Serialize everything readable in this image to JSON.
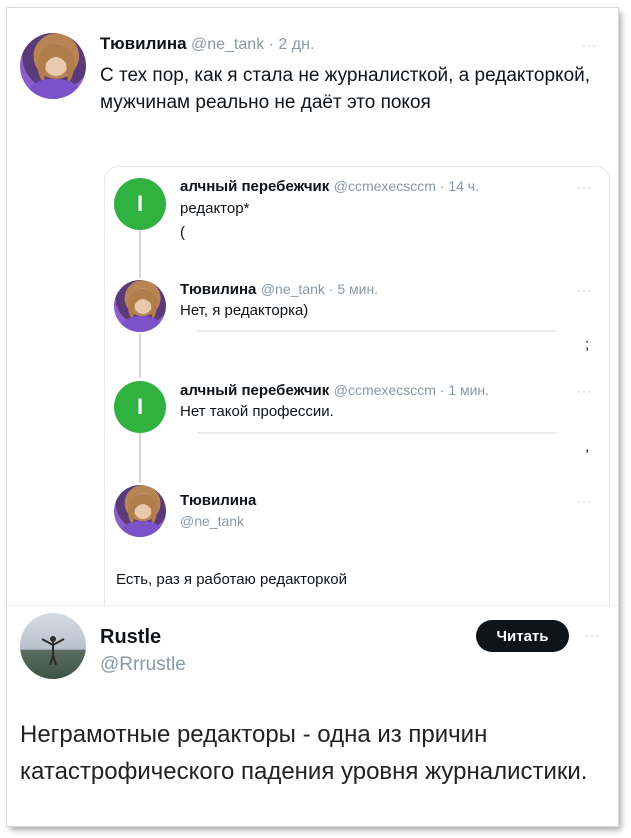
{
  "tweet": {
    "author": "Тювилина",
    "handle": "@ne_tank",
    "time": "2 дн.",
    "text": "С тех пор, как я стала не журналисткой, а редакторкой, мужчинам реально не даёт это покоя",
    "more": "···"
  },
  "quote": {
    "items": [
      {
        "author": "алчный перебежчик",
        "handle": "@ccmexecsccm",
        "time": "14 ч.",
        "text": "редактор*",
        "extra": "(",
        "avatar_letter": "I"
      },
      {
        "author": "Тювилина",
        "handle": "@ne_tank",
        "time": "5 мин.",
        "text": "Нет, я редакторка)",
        "extra": ";"
      },
      {
        "author": "алчный перебежчик",
        "handle": "@ccmexecsccm",
        "time": "1 мин.",
        "text": "Нет такой профессии.",
        "extra": ",",
        "avatar_letter": "I"
      },
      {
        "author": "Тювилина",
        "handle": "@ne_tank",
        "text": "Есть, раз я работаю редакторкой"
      }
    ]
  },
  "reply": {
    "author": "Rustle",
    "handle": "@Rrrustle",
    "button": "Читать",
    "text": "Неграмотные редакторы - одна из причин катастрофического падения уровня журналистики."
  },
  "colors": {
    "green_avatar": "#2fb240",
    "button_bg": "#0f1419",
    "meta": "#8899a6"
  }
}
